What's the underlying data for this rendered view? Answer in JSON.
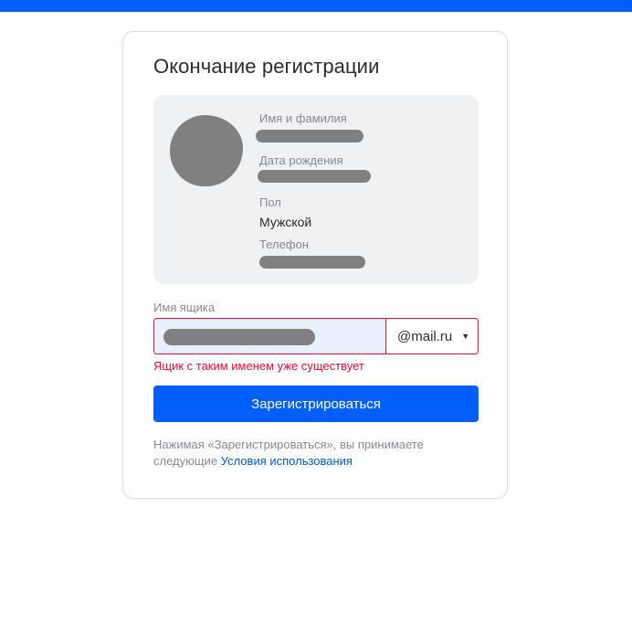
{
  "colors": {
    "accent": "#005ff9",
    "error": "#ed0a34",
    "link": "#005bd1",
    "muted": "#87898f",
    "panel_bg": "#f0f1f3",
    "input_autofill_bg": "#e8f0fe"
  },
  "card": {
    "title": "Окончание регистрации"
  },
  "profile": {
    "fields": [
      {
        "label": "Имя и фамилия",
        "value": ""
      },
      {
        "label": "Дата рождения",
        "value": ""
      },
      {
        "label": "Пол",
        "value": "Мужской"
      },
      {
        "label": "Телефон",
        "value": ""
      }
    ]
  },
  "mailbox": {
    "label": "Имя ящика",
    "value": "",
    "domain": "@mail.ru",
    "error": "Ящик с таким именем уже существует"
  },
  "submit": {
    "label": "Зарегистрироваться"
  },
  "terms": {
    "text": "Нажимая «Зарегистрироваться», вы принимаете следующие",
    "link": "Условия использования"
  }
}
